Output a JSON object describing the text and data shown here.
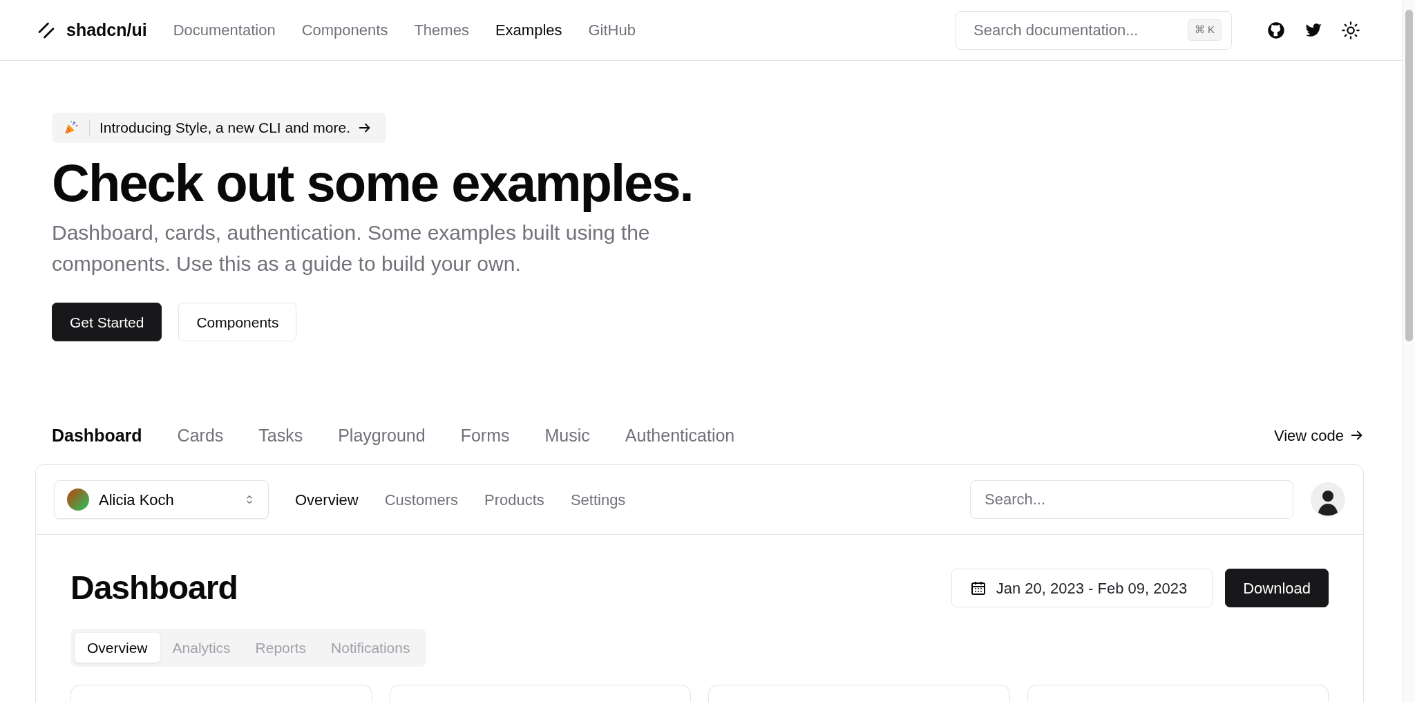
{
  "header": {
    "logo": "shadcn/ui",
    "nav": [
      {
        "label": "Documentation",
        "selected": false
      },
      {
        "label": "Components",
        "selected": false
      },
      {
        "label": "Themes",
        "selected": false
      },
      {
        "label": "Examples",
        "selected": true
      },
      {
        "label": "GitHub",
        "selected": false
      }
    ],
    "search": {
      "placeholder": "Search documentation...",
      "shortcut": "⌘ K"
    }
  },
  "hero": {
    "announcement": "Introducing Style, a new CLI and more.",
    "title": "Check out some examples.",
    "subtitle": "Dashboard, cards, authentication. Some examples built using the components. Use this as a guide to build your own.",
    "buttons": [
      {
        "label": "Get Started",
        "kind": "primary"
      },
      {
        "label": "Components",
        "kind": "outline"
      }
    ]
  },
  "examples": {
    "tabs": [
      {
        "label": "Dashboard",
        "selected": true
      },
      {
        "label": "Cards",
        "selected": false
      },
      {
        "label": "Tasks",
        "selected": false
      },
      {
        "label": "Playground",
        "selected": false
      },
      {
        "label": "Forms",
        "selected": false
      },
      {
        "label": "Music",
        "selected": false
      },
      {
        "label": "Authentication",
        "selected": false
      }
    ],
    "view_code": "View code"
  },
  "dashboard": {
    "team": "Alicia Koch",
    "nav": [
      {
        "label": "Overview",
        "selected": true
      },
      {
        "label": "Customers",
        "selected": false
      },
      {
        "label": "Products",
        "selected": false
      },
      {
        "label": "Settings",
        "selected": false
      }
    ],
    "search": {
      "placeholder": "Search..."
    },
    "title": "Dashboard",
    "date_range": "Jan 20, 2023 - Feb 09, 2023",
    "download": "Download",
    "tabs": [
      {
        "label": "Overview",
        "selected": true
      },
      {
        "label": "Analytics",
        "selected": false
      },
      {
        "label": "Reports",
        "selected": false
      },
      {
        "label": "Notifications",
        "selected": false
      }
    ]
  }
}
